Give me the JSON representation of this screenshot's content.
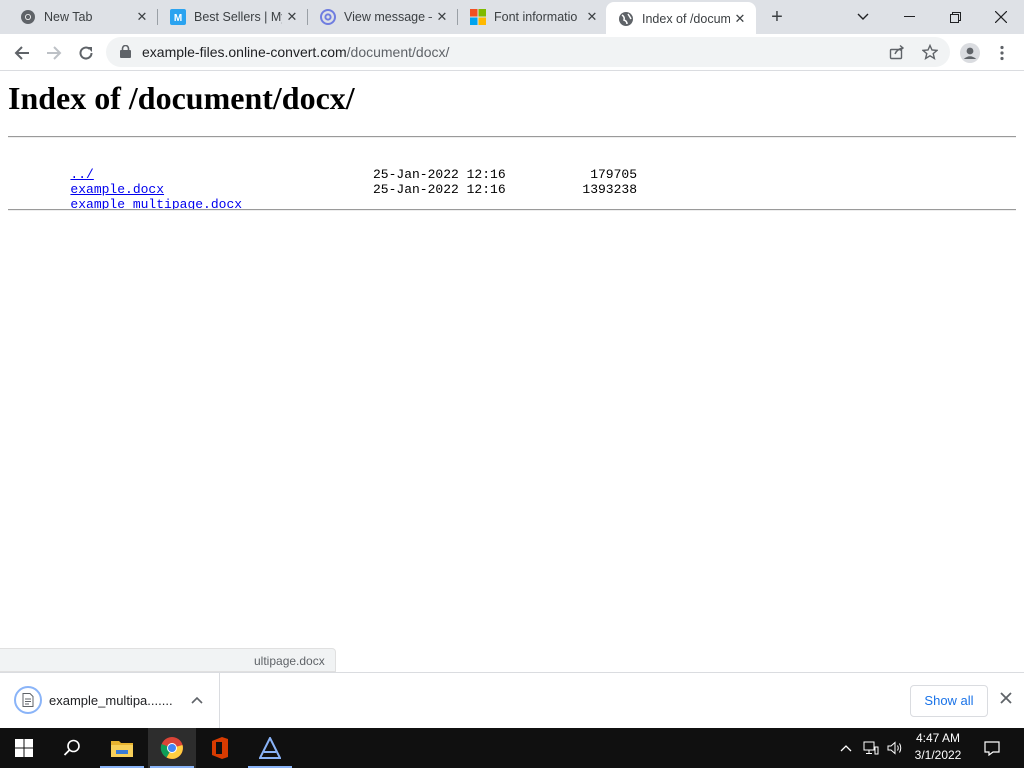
{
  "browser": {
    "tabs": [
      {
        "title": "New Tab",
        "icon": "chrome-icon"
      },
      {
        "title": "Best Sellers | My",
        "icon": "mysite-icon"
      },
      {
        "title": "View message –",
        "icon": "at-sign-icon"
      },
      {
        "title": "Font informatio",
        "icon": "microsoft-logo-icon"
      },
      {
        "title": "Index of /docum",
        "icon": "globe-icon",
        "active": true
      }
    ],
    "url_host": "example-files.online-convert.com",
    "url_path": "/document/docx/"
  },
  "page": {
    "heading": "Index of /document/docx/",
    "parent_link": "../",
    "files": [
      {
        "name": "example.docx",
        "date": "25-Jan-2022 12:16",
        "size": "179705"
      },
      {
        "name": "example_multipage.docx",
        "date": "25-Jan-2022 12:16",
        "size": "1393238"
      }
    ],
    "status_text": "ultipage.docx"
  },
  "downloads": {
    "item_name": "example_multipa.......",
    "show_all": "Show all"
  },
  "taskbar": {
    "time": "4:47 AM",
    "date": "3/1/2022"
  },
  "colors": {
    "tabstrip": "#dee1e6",
    "link": "#0000ee",
    "accent": "#1a73e8"
  }
}
